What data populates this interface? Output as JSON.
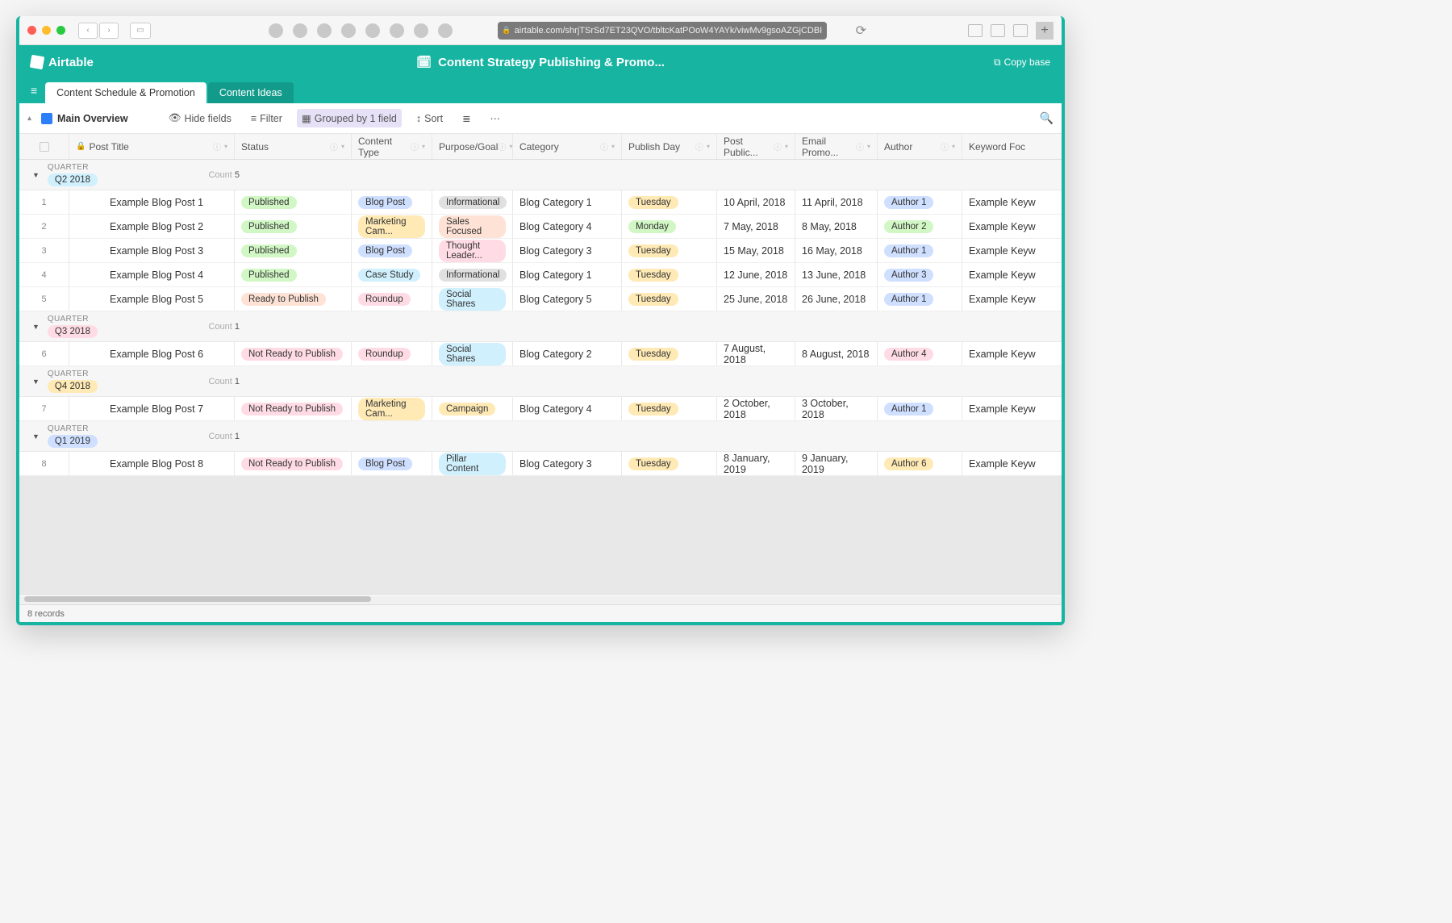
{
  "browser": {
    "url": "airtable.com/shrjTSrSd7ET23QVO/tbltcKatPOoW4YAYk/viwMv9gsoAZGjCDBI"
  },
  "app": {
    "brand": "Airtable",
    "base_title": "Content Strategy Publishing & Promo...",
    "copy_base": "Copy base"
  },
  "tabs": [
    {
      "label": "Content Schedule & Promotion",
      "active": true
    },
    {
      "label": "Content Ideas",
      "active": false
    }
  ],
  "viewbar": {
    "view_name": "Main Overview",
    "hide_fields": "Hide fields",
    "filter": "Filter",
    "grouped": "Grouped by 1 field",
    "sort": "Sort"
  },
  "columns": {
    "post_title": "Post Title",
    "status": "Status",
    "content_type": "Content Type",
    "purpose": "Purpose/Goal",
    "category": "Category",
    "publish_day": "Publish Day",
    "post_public": "Post Public...",
    "email_promo": "Email Promo...",
    "author": "Author",
    "keyword": "Keyword Foc"
  },
  "group_label": "QUARTER",
  "count_label": "Count",
  "pill_colors": {
    "Published": "#d1f7c4",
    "Ready to Publish": "#fee2d5",
    "Not Ready to Publish": "#ffdce5",
    "Blog Post": "#cfdfff",
    "Marketing Cam...": "#ffeab6",
    "Case Study": "#d0f0fd",
    "Roundup": "#ffdce5",
    "Informational": "#e0e0e0",
    "Sales Focused": "#fee2d5",
    "Thought Leader...": "#ffdce5",
    "Social Shares": "#d0f0fd",
    "Campaign": "#ffeab6",
    "Pillar Content": "#d0f0fd",
    "Tuesday": "#ffeab6",
    "Monday": "#d1f7c4",
    "Author 1": "#cfdfff",
    "Author 2": "#d1f7c4",
    "Author 3": "#cfdfff",
    "Author 4": "#ffdce5",
    "Author 6": "#ffeab6",
    "Q2 2018": "#d0f0fd",
    "Q3 2018": "#ffdce5",
    "Q4 2018": "#ffeab6",
    "Q1 2019": "#cfdfff"
  },
  "groups": [
    {
      "quarter": "Q2 2018",
      "count": "5",
      "rows": [
        {
          "n": "1",
          "title": "Example Blog Post 1",
          "status": "Published",
          "ctype": "Blog Post",
          "purpose": "Informational",
          "category": "Blog Category 1",
          "day": "Tuesday",
          "pub": "10 April, 2018",
          "email": "11 April, 2018",
          "author": "Author 1",
          "keyword": "Example Keyw"
        },
        {
          "n": "2",
          "title": "Example Blog Post 2",
          "status": "Published",
          "ctype": "Marketing Cam...",
          "purpose": "Sales Focused",
          "category": "Blog Category 4",
          "day": "Monday",
          "pub": "7 May, 2018",
          "email": "8 May, 2018",
          "author": "Author 2",
          "keyword": "Example Keyw"
        },
        {
          "n": "3",
          "title": "Example Blog Post 3",
          "status": "Published",
          "ctype": "Blog Post",
          "purpose": "Thought Leader...",
          "category": "Blog Category 3",
          "day": "Tuesday",
          "pub": "15 May, 2018",
          "email": "16 May, 2018",
          "author": "Author 1",
          "keyword": "Example Keyw"
        },
        {
          "n": "4",
          "title": "Example Blog Post 4",
          "status": "Published",
          "ctype": "Case Study",
          "purpose": "Informational",
          "category": "Blog Category 1",
          "day": "Tuesday",
          "pub": "12 June, 2018",
          "email": "13 June, 2018",
          "author": "Author 3",
          "keyword": "Example Keyw"
        },
        {
          "n": "5",
          "title": "Example Blog Post 5",
          "status": "Ready to Publish",
          "ctype": "Roundup",
          "purpose": "Social Shares",
          "category": "Blog Category 5",
          "day": "Tuesday",
          "pub": "25 June, 2018",
          "email": "26 June, 2018",
          "author": "Author 1",
          "keyword": "Example Keyw"
        }
      ]
    },
    {
      "quarter": "Q3 2018",
      "count": "1",
      "rows": [
        {
          "n": "6",
          "title": "Example Blog Post 6",
          "status": "Not Ready to Publish",
          "ctype": "Roundup",
          "purpose": "Social Shares",
          "category": "Blog Category 2",
          "day": "Tuesday",
          "pub": "7 August, 2018",
          "email": "8 August, 2018",
          "author": "Author 4",
          "keyword": "Example Keyw"
        }
      ]
    },
    {
      "quarter": "Q4 2018",
      "count": "1",
      "rows": [
        {
          "n": "7",
          "title": "Example Blog Post 7",
          "status": "Not Ready to Publish",
          "ctype": "Marketing Cam...",
          "purpose": "Campaign",
          "category": "Blog Category 4",
          "day": "Tuesday",
          "pub": "2 October, 2018",
          "email": "3 October, 2018",
          "author": "Author 1",
          "keyword": "Example Keyw"
        }
      ]
    },
    {
      "quarter": "Q1 2019",
      "count": "1",
      "rows": [
        {
          "n": "8",
          "title": "Example Blog Post 8",
          "status": "Not Ready to Publish",
          "ctype": "Blog Post",
          "purpose": "Pillar Content",
          "category": "Blog Category 3",
          "day": "Tuesday",
          "pub": "8 January, 2019",
          "email": "9 January, 2019",
          "author": "Author 6",
          "keyword": "Example Keyw"
        }
      ]
    }
  ],
  "footer": {
    "records": "8 records"
  }
}
